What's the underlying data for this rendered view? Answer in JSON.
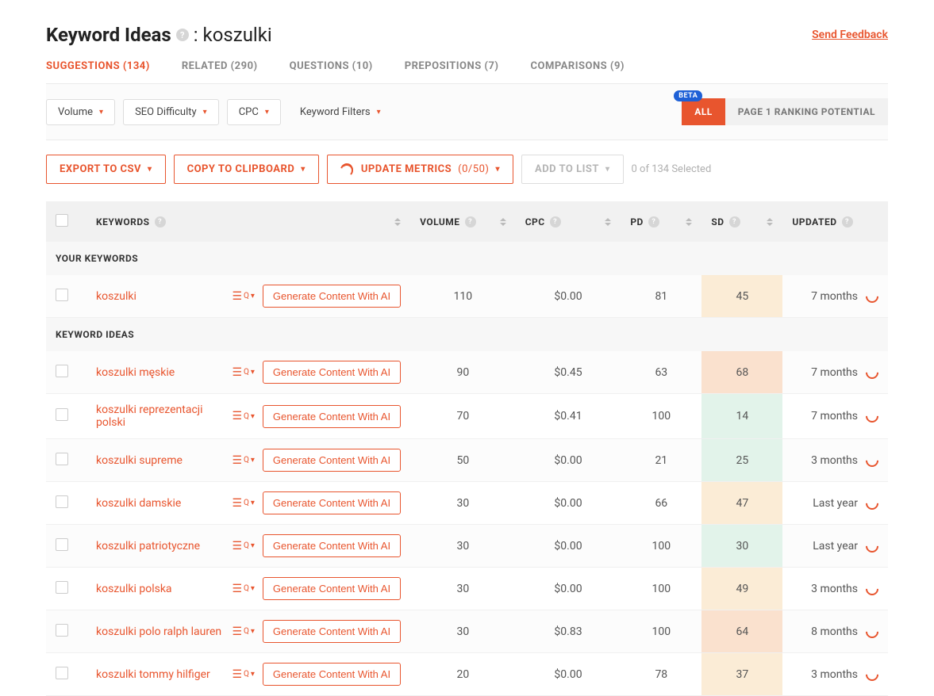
{
  "header": {
    "title_prefix": "Keyword Ideas",
    "title_keyword": "koszulki",
    "feedback": "Send Feedback"
  },
  "tabs": [
    {
      "label": "SUGGESTIONS (134)",
      "active": true
    },
    {
      "label": "RELATED (290)",
      "active": false
    },
    {
      "label": "QUESTIONS (10)",
      "active": false
    },
    {
      "label": "PREPOSITIONS (7)",
      "active": false
    },
    {
      "label": "COMPARISONS (9)",
      "active": false
    }
  ],
  "filters": {
    "volume": "Volume",
    "seo": "SEO Difficulty",
    "cpc": "CPC",
    "kw_filters": "Keyword Filters",
    "beta": "BETA",
    "all": "ALL",
    "p1": "PAGE 1 RANKING POTENTIAL"
  },
  "actions": {
    "export": "EXPORT TO CSV",
    "copy": "COPY TO CLIPBOARD",
    "update": "UPDATE METRICS",
    "update_count": "(0/50)",
    "add": "ADD TO LIST",
    "selected": "0 of 134 Selected"
  },
  "columns": {
    "keywords": "KEYWORDS",
    "volume": "VOLUME",
    "cpc": "CPC",
    "pd": "PD",
    "sd": "SD",
    "updated": "UPDATED"
  },
  "sections": {
    "your": "YOUR KEYWORDS",
    "ideas": "KEYWORD IDEAS"
  },
  "gen_label": "Generate Content With AI",
  "rows_your": [
    {
      "kw": "koszulki",
      "vol": "110",
      "cpc": "$0.00",
      "pd": "81",
      "sd": "45",
      "sd_class": "sd-yellow",
      "upd": "7 months"
    }
  ],
  "rows_ideas": [
    {
      "kw": "koszulki męskie",
      "vol": "90",
      "cpc": "$0.45",
      "pd": "63",
      "sd": "68",
      "sd_class": "sd-orange",
      "upd": "7 months"
    },
    {
      "kw": "koszulki reprezentacji polski",
      "vol": "70",
      "cpc": "$0.41",
      "pd": "100",
      "sd": "14",
      "sd_class": "sd-green",
      "upd": "7 months"
    },
    {
      "kw": "koszulki supreme",
      "vol": "50",
      "cpc": "$0.00",
      "pd": "21",
      "sd": "25",
      "sd_class": "sd-green",
      "upd": "3 months"
    },
    {
      "kw": "koszulki damskie",
      "vol": "30",
      "cpc": "$0.00",
      "pd": "66",
      "sd": "47",
      "sd_class": "sd-yellow",
      "upd": "Last year"
    },
    {
      "kw": "koszulki patriotyczne",
      "vol": "30",
      "cpc": "$0.00",
      "pd": "100",
      "sd": "30",
      "sd_class": "sd-green",
      "upd": "Last year"
    },
    {
      "kw": "koszulki polska",
      "vol": "30",
      "cpc": "$0.00",
      "pd": "100",
      "sd": "49",
      "sd_class": "sd-yellow",
      "upd": "3 months"
    },
    {
      "kw": "koszulki polo ralph lauren",
      "vol": "30",
      "cpc": "$0.83",
      "pd": "100",
      "sd": "64",
      "sd_class": "sd-orange",
      "upd": "8 months"
    },
    {
      "kw": "koszulki tommy hilfiger",
      "vol": "20",
      "cpc": "$0.00",
      "pd": "78",
      "sd": "37",
      "sd_class": "sd-yellow",
      "upd": "3 months"
    }
  ]
}
